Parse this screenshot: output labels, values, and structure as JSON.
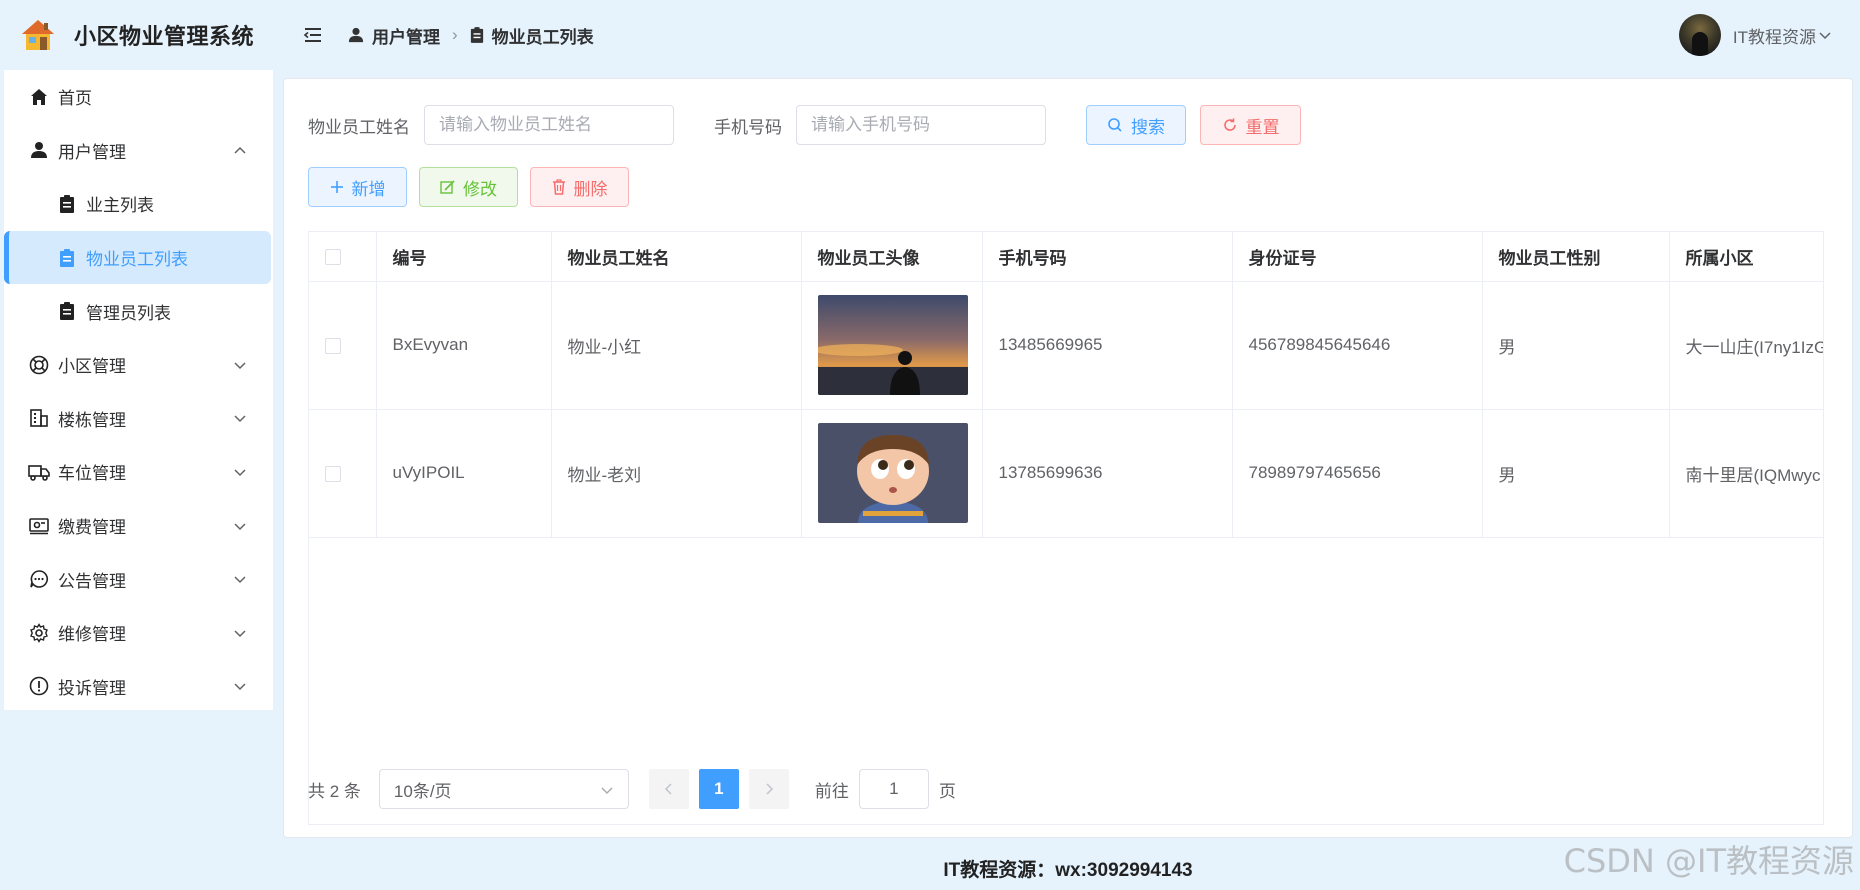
{
  "app": {
    "title": "小区物业管理系统"
  },
  "sidebar": {
    "items": [
      {
        "label": "首页",
        "icon": "home-icon",
        "expandable": false
      },
      {
        "label": "用户管理",
        "icon": "user-icon",
        "expandable": true,
        "expanded": true
      },
      {
        "label": "业主列表",
        "icon": "clipboard-icon",
        "sub": true
      },
      {
        "label": "物业员工列表",
        "icon": "clipboard-icon",
        "sub": true,
        "active": true
      },
      {
        "label": "管理员列表",
        "icon": "clipboard-icon",
        "sub": true
      },
      {
        "label": "小区管理",
        "icon": "lifebuoy-icon",
        "expandable": true
      },
      {
        "label": "楼栋管理",
        "icon": "building-icon",
        "expandable": true
      },
      {
        "label": "车位管理",
        "icon": "truck-icon",
        "expandable": true
      },
      {
        "label": "缴费管理",
        "icon": "wallet-icon",
        "expandable": true
      },
      {
        "label": "公告管理",
        "icon": "chat-icon",
        "expandable": true
      },
      {
        "label": "维修管理",
        "icon": "gear-icon",
        "expandable": true
      },
      {
        "label": "投诉管理",
        "icon": "warning-icon",
        "expandable": true
      }
    ]
  },
  "header": {
    "breadcrumb": [
      "用户管理",
      "物业员工列表"
    ],
    "username": "IT教程资源"
  },
  "search": {
    "name_label": "物业员工姓名",
    "name_placeholder": "请输入物业员工姓名",
    "phone_label": "手机号码",
    "phone_placeholder": "请输入手机号码",
    "search_label": "搜索",
    "reset_label": "重置"
  },
  "actions": {
    "add_label": "新增",
    "edit_label": "修改",
    "delete_label": "删除"
  },
  "table": {
    "columns": [
      "编号",
      "物业员工姓名",
      "物业员工头像",
      "手机号码",
      "身份证号",
      "物业员工性别",
      "所属小区"
    ],
    "rows": [
      {
        "id": "BxEvyvan",
        "name": "物业-小红",
        "avatar": "sunset-silhouette",
        "phone": "13485669965",
        "id_card": "456789845645646",
        "gender": "男",
        "community": "大一山庄(I7ny1IzG"
      },
      {
        "id": "uVyIPOIL",
        "name": "物业-老刘",
        "avatar": "cartoon-boy",
        "phone": "13785699636",
        "id_card": "78989797465656",
        "gender": "男",
        "community": "南十里居(IQMwyc"
      }
    ]
  },
  "pagination": {
    "total_text": "共 2 条",
    "page_size": "10条/页",
    "current_page": "1",
    "goto_prefix": "前往",
    "goto_value": "1",
    "goto_suffix": "页"
  },
  "footer": {
    "text": "IT教程资源：wx:3092994143"
  },
  "watermark": "CSDN @IT教程资源",
  "colors": {
    "primary": "#409eff",
    "danger": "#f56c6c",
    "success": "#67c23a",
    "background": "#e6f3fd"
  }
}
